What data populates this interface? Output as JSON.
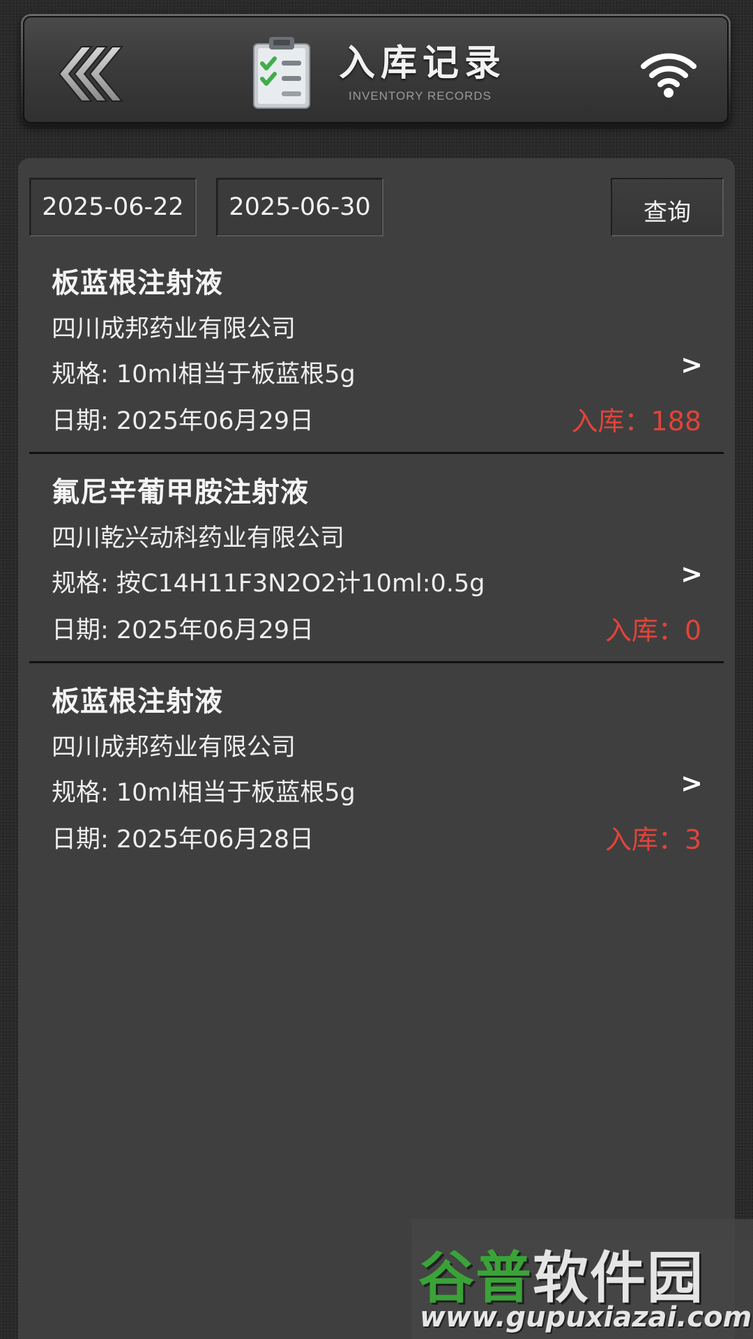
{
  "header": {
    "title": "入库记录",
    "subtitle": "INVENTORY RECORDS",
    "back_icon": "double-chevron-left-icon",
    "title_icon": "clipboard-checklist-icon",
    "status_icon": "wifi-icon"
  },
  "filter": {
    "start_date": "2025-06-22",
    "end_date": "2025-06-30",
    "query_label": "查询"
  },
  "records": [
    {
      "name": "板蓝根注射液",
      "company": "四川成邦药业有限公司",
      "spec": "规格: 10ml相当于板蓝根5g",
      "date": "日期: 2025年06月29日",
      "quantity": "入库：188",
      "arrow": ">"
    },
    {
      "name": "氟尼辛葡甲胺注射液",
      "company": "四川乾兴动科药业有限公司",
      "spec": "规格: 按C14H11F3N2O2计10ml:0.5g",
      "date": "日期: 2025年06月29日",
      "quantity": "入库：0",
      "arrow": ">"
    },
    {
      "name": "板蓝根注射液",
      "company": "四川成邦药业有限公司",
      "spec": "规格: 10ml相当于板蓝根5g",
      "date": "日期: 2025年06月28日",
      "quantity": "入库：3",
      "arrow": ">"
    }
  ],
  "watermark": {
    "brand_green": "谷普",
    "brand_rest": "软件园",
    "url": "www.gupuxiazai.com"
  },
  "colors": {
    "background": "#2a2a2a",
    "panel": "#3f3f3f",
    "quantity_red": "#e0443a",
    "check_green": "#3fae4a",
    "watermark_green": "#3aa838"
  }
}
